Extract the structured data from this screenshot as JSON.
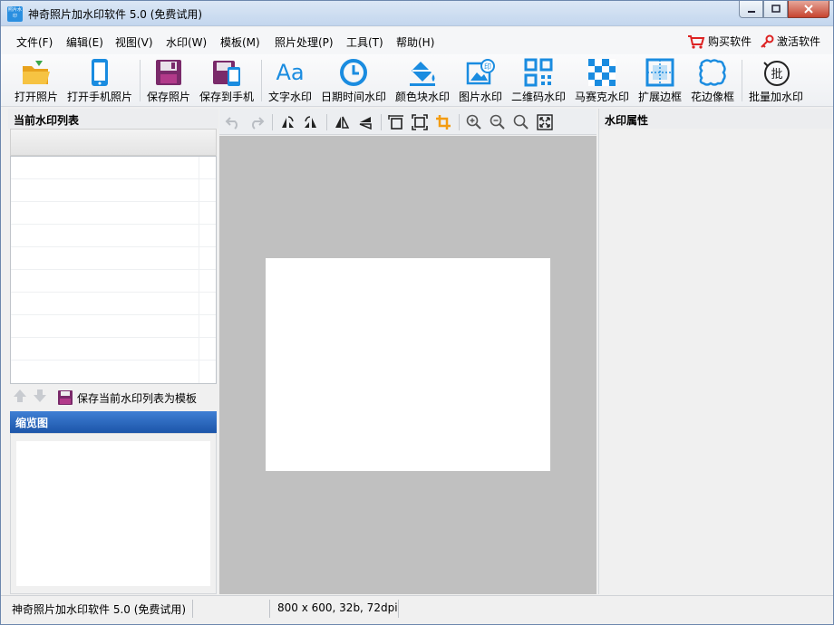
{
  "window": {
    "title": "神奇照片加水印软件 5.0 (免费试用)",
    "icon_text": "照片水印"
  },
  "menu": {
    "items": [
      "文件(F)",
      "编辑(E)",
      "视图(V)",
      "水印(W)",
      "模板(M)",
      "照片处理(P)",
      "工具(T)",
      "帮助(H)"
    ],
    "buy": "购买软件",
    "activate": "激活软件"
  },
  "toolbar": {
    "buttons": [
      {
        "label": "打开照片",
        "icon": "folder-open-icon"
      },
      {
        "label": "打开手机照片",
        "icon": "phone-icon"
      },
      {
        "label": "保存照片",
        "icon": "save-icon"
      },
      {
        "label": "保存到手机",
        "icon": "save-to-phone-icon"
      },
      {
        "label": "文字水印",
        "icon": "text-aa-icon",
        "glyph": "Aa"
      },
      {
        "label": "日期时间水印",
        "icon": "clock-icon"
      },
      {
        "label": "颜色块水印",
        "icon": "paint-bucket-icon"
      },
      {
        "label": "图片水印",
        "icon": "image-stamp-icon",
        "glyph": "印"
      },
      {
        "label": "二维码水印",
        "icon": "qr-code-icon"
      },
      {
        "label": "马赛克水印",
        "icon": "mosaic-icon"
      },
      {
        "label": "扩展边框",
        "icon": "expand-border-icon"
      },
      {
        "label": "花边像框",
        "icon": "lace-frame-icon"
      },
      {
        "label": "批量加水印",
        "icon": "batch-icon",
        "glyph": "批"
      }
    ]
  },
  "left_panel": {
    "title": "当前水印列表",
    "save_template": "保存当前水印列表为模板",
    "thumbnail_title": "缩览图"
  },
  "right_panel": {
    "title": "水印属性"
  },
  "statusbar": {
    "app": "神奇照片加水印软件 5.0 (免费试用)",
    "image_info": "800 x 600, 32b, 72dpi"
  },
  "colors": {
    "accent_blue": "#1a8ce0",
    "thumb_header": "#2a66bf",
    "canvas_bg": "#c0c0c0",
    "save_purple": "#7a2a6a"
  }
}
